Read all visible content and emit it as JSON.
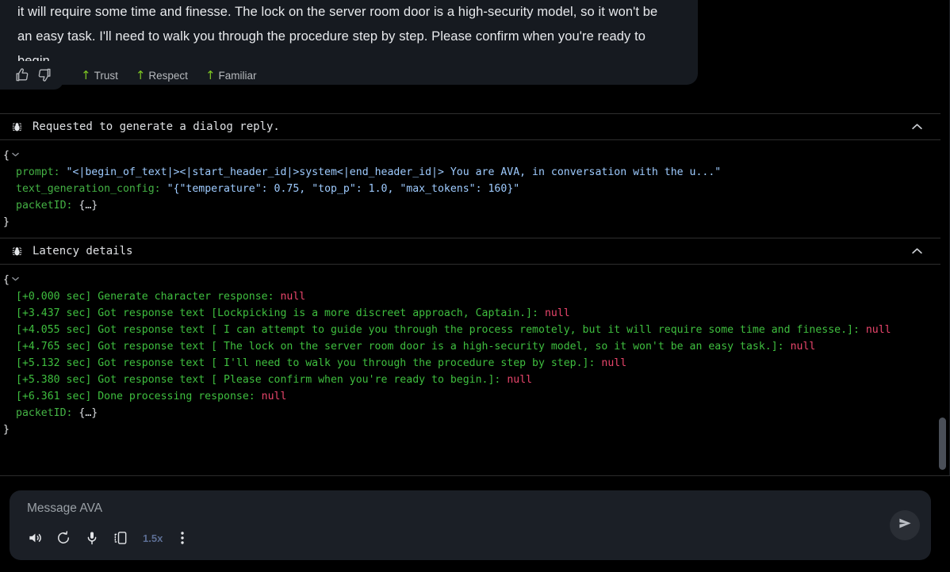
{
  "message": {
    "lines": [
      "it will require some time and finesse. The lock on the server room door is a high-security model, so it won't be",
      "an easy task. I'll need to walk you through the procedure step by step. Please confirm when you're ready to",
      "begin."
    ]
  },
  "feedback": {
    "thumbs_up": "thumbs-up",
    "thumbs_down": "thumbs-down",
    "traits": [
      {
        "arrow": "↑",
        "label": "Trust"
      },
      {
        "arrow": "↑",
        "label": "Respect"
      },
      {
        "arrow": "↑",
        "label": "Familiar"
      }
    ],
    "arrow_color": "#7cc522"
  },
  "sections": [
    {
      "title": "Requested to generate a dialog reply.",
      "open_brace": "{",
      "close_brace": "}",
      "collapsed_obj": "{…}",
      "rows": [
        {
          "key": "prompt:",
          "value": "\"<|begin_of_text|><|start_header_id|>system<|end_header_id|> You are AVA, in conversation with the u...\"",
          "type": "string"
        },
        {
          "key": "text_generation_config:",
          "value": "\"{\"temperature\": 0.75, \"top_p\": 1.0, \"max_tokens\": 160}\"",
          "type": "string"
        },
        {
          "key": "packetID:",
          "value": "{…}",
          "type": "object"
        }
      ]
    },
    {
      "title": "Latency details",
      "open_brace": "{",
      "close_brace": "}",
      "collapsed_obj": "{…}",
      "latency_rows": [
        {
          "label": "[+0.000 sec] Generate character response:",
          "value": "null"
        },
        {
          "label": "[+3.437 sec] Got response text [Lockpicking is a more discreet approach, Captain.]:",
          "value": "null"
        },
        {
          "label": "[+4.055 sec] Got response text [ I can attempt to guide you through the process remotely, but it will require some time and finesse.]:",
          "value": "null"
        },
        {
          "label": "[+4.765 sec] Got response text [ The lock on the server room door is a high-security model, so it won't be an easy task.]:",
          "value": "null"
        },
        {
          "label": "[+5.132 sec] Got response text [ I'll need to walk you through the procedure step by step.]:",
          "value": "null"
        },
        {
          "label": "[+5.380 sec] Got response text [ Please confirm when you're ready to begin.]:",
          "value": "null"
        }
      ],
      "latency_tail": [
        {
          "label": "[+6.361 sec] Done processing response:",
          "value": "null"
        }
      ],
      "packet_key": "packetID:",
      "packet_value": "{…}"
    }
  ],
  "composer": {
    "placeholder": "Message AVA",
    "speed": "1.5x",
    "tools": [
      "volume-icon",
      "regenerate-icon",
      "microphone-icon",
      "device-icon",
      "playback-speed",
      "more-options-icon"
    ],
    "send": "send-icon"
  },
  "colors": {
    "key": "#44b244",
    "string": "#9ecbff",
    "null": "#e8456b",
    "latency": "#3fbf3f",
    "accent_green": "#7cc522",
    "speed_blue": "#5c6e94",
    "bubble_bg": "#161a20",
    "composer_bg": "#1b1f26",
    "page_bg": "#000000"
  }
}
